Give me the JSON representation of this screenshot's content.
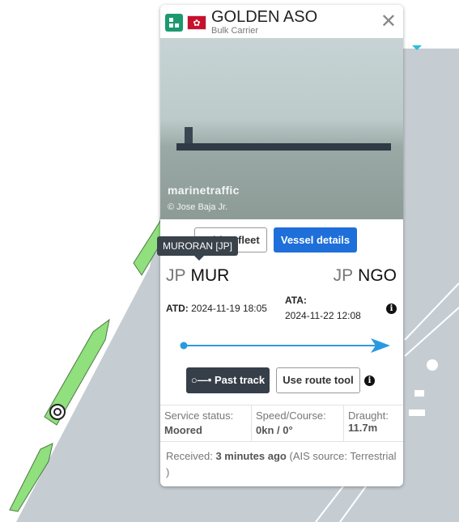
{
  "vessel": {
    "name": "GOLDEN ASO",
    "type": "Bulk Carrier",
    "flag": "Hong Kong",
    "type_color": "#1a9a6e"
  },
  "photo": {
    "watermark": "marinetraffic",
    "credit": "© Jose Baja Jr."
  },
  "buttons": {
    "add_fleet": "Add to fleet",
    "vessel_details": "Vessel details",
    "past_track": "Past track",
    "route_tool": "Use route tool"
  },
  "tooltip": "MURORAN [JP]",
  "voyage": {
    "departure": {
      "country": "JP",
      "port": "MUR"
    },
    "arrival": {
      "country": "JP",
      "port": "NGO"
    },
    "atd_label": "ATD:",
    "atd": "2024-11-19 18:05",
    "ata_label": "ATA:",
    "ata": "2024-11-22 12:08",
    "progress": 1.0
  },
  "status": [
    {
      "label": "Service status:",
      "value": "Moored"
    },
    {
      "label": "Speed/Course:",
      "value": "0kn / 0°"
    },
    {
      "label": "Draught:",
      "value": "11.7m"
    }
  ],
  "received": {
    "label": "Received:",
    "value": "3 minutes ago",
    "source": "(AIS source: Terrestrial )"
  },
  "colors": {
    "accent": "#1e6fd9",
    "route": "#2a9ae0",
    "land": "#c5cdd3"
  }
}
